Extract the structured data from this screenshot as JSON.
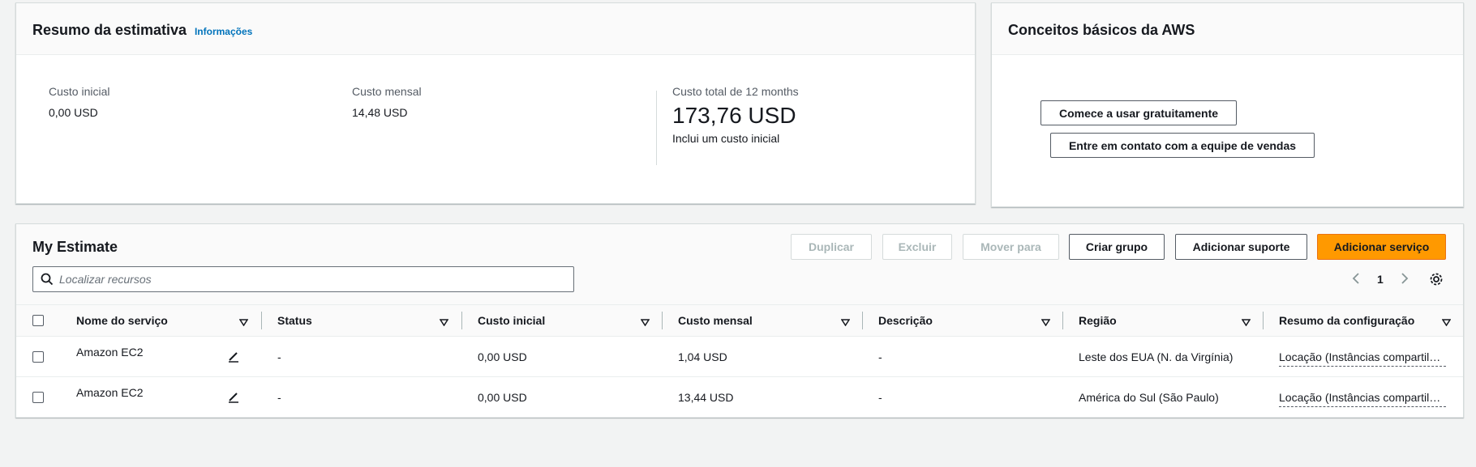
{
  "summary": {
    "title": "Resumo da estimativa",
    "info_link": "Informações",
    "upfront_label": "Custo inicial",
    "upfront_value": "0,00 USD",
    "monthly_label": "Custo mensal",
    "monthly_value": "14,48 USD",
    "total_label": "Custo total de 12 months",
    "total_value": "173,76 USD",
    "total_note": "Inclui um custo inicial"
  },
  "basics": {
    "title": "Conceitos básicos da AWS",
    "start_free_label": "Comece a usar gratuitamente",
    "contact_sales_label": "Entre em contato com a equipe de vendas"
  },
  "estimate": {
    "title": "My Estimate",
    "buttons": {
      "duplicate": "Duplicar",
      "delete": "Excluir",
      "move_to": "Mover para",
      "create_group": "Criar grupo",
      "add_support": "Adicionar suporte",
      "add_service": "Adicionar serviço"
    },
    "search_placeholder": "Localizar recursos",
    "page_number": "1",
    "columns": [
      "Nome do serviço",
      "Status",
      "Custo inicial",
      "Custo mensal",
      "Descrição",
      "Região",
      "Resumo da configuração"
    ],
    "rows": [
      {
        "service": "Amazon EC2",
        "status": "-",
        "upfront": "0,00 USD",
        "monthly": "1,04 USD",
        "description": "-",
        "region": "Leste dos EUA (N. da Virgínia)",
        "config": "Locação (Instâncias compartilhadas)"
      },
      {
        "service": "Amazon EC2",
        "status": "-",
        "upfront": "0,00 USD",
        "monthly": "13,44 USD",
        "description": "-",
        "region": "América do Sul (São Paulo)",
        "config": "Locação (Instâncias compartilhadas)"
      }
    ]
  },
  "colors": {
    "primary_button": "#ff9900",
    "link": "#0073bb",
    "background": "#f2f3f3"
  }
}
